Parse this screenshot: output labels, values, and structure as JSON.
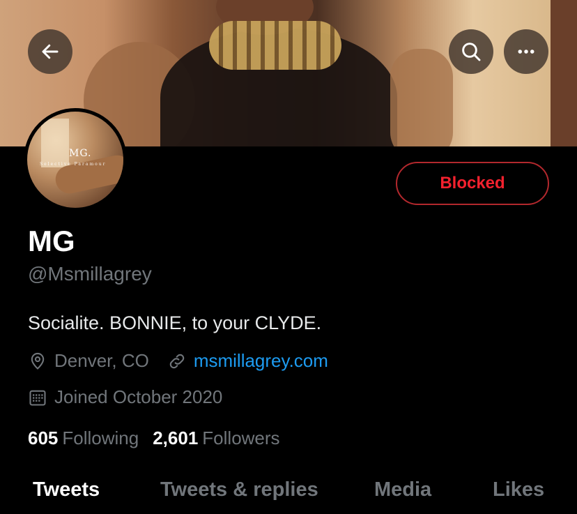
{
  "profile": {
    "name": "MG",
    "handle": "@Msmillagrey",
    "bio": "Socialite. BONNIE, to your CLYDE.",
    "location": "Denver, CO",
    "website": "msmillagrey.com",
    "joined": "Joined October 2020",
    "avatar_text": "MG.",
    "avatar_subtext": "Selective Paramour"
  },
  "actions": {
    "blocked_label": "Blocked"
  },
  "stats": {
    "following_count": "605",
    "following_label": "Following",
    "followers_count": "2,601",
    "followers_label": "Followers"
  },
  "tabs": [
    {
      "label": "Tweets",
      "active": true
    },
    {
      "label": "Tweets & replies",
      "active": false
    },
    {
      "label": "Media",
      "active": false
    },
    {
      "label": "Likes",
      "active": false
    }
  ],
  "icons": {
    "back": "arrow-left-icon",
    "search": "search-icon",
    "more": "more-icon",
    "location": "location-pin-icon",
    "link": "link-icon",
    "calendar": "calendar-icon"
  },
  "colors": {
    "background": "#000000",
    "blocked_red": "#f4212e",
    "link_blue": "#1d9bf0",
    "muted_gray": "#71767b"
  }
}
